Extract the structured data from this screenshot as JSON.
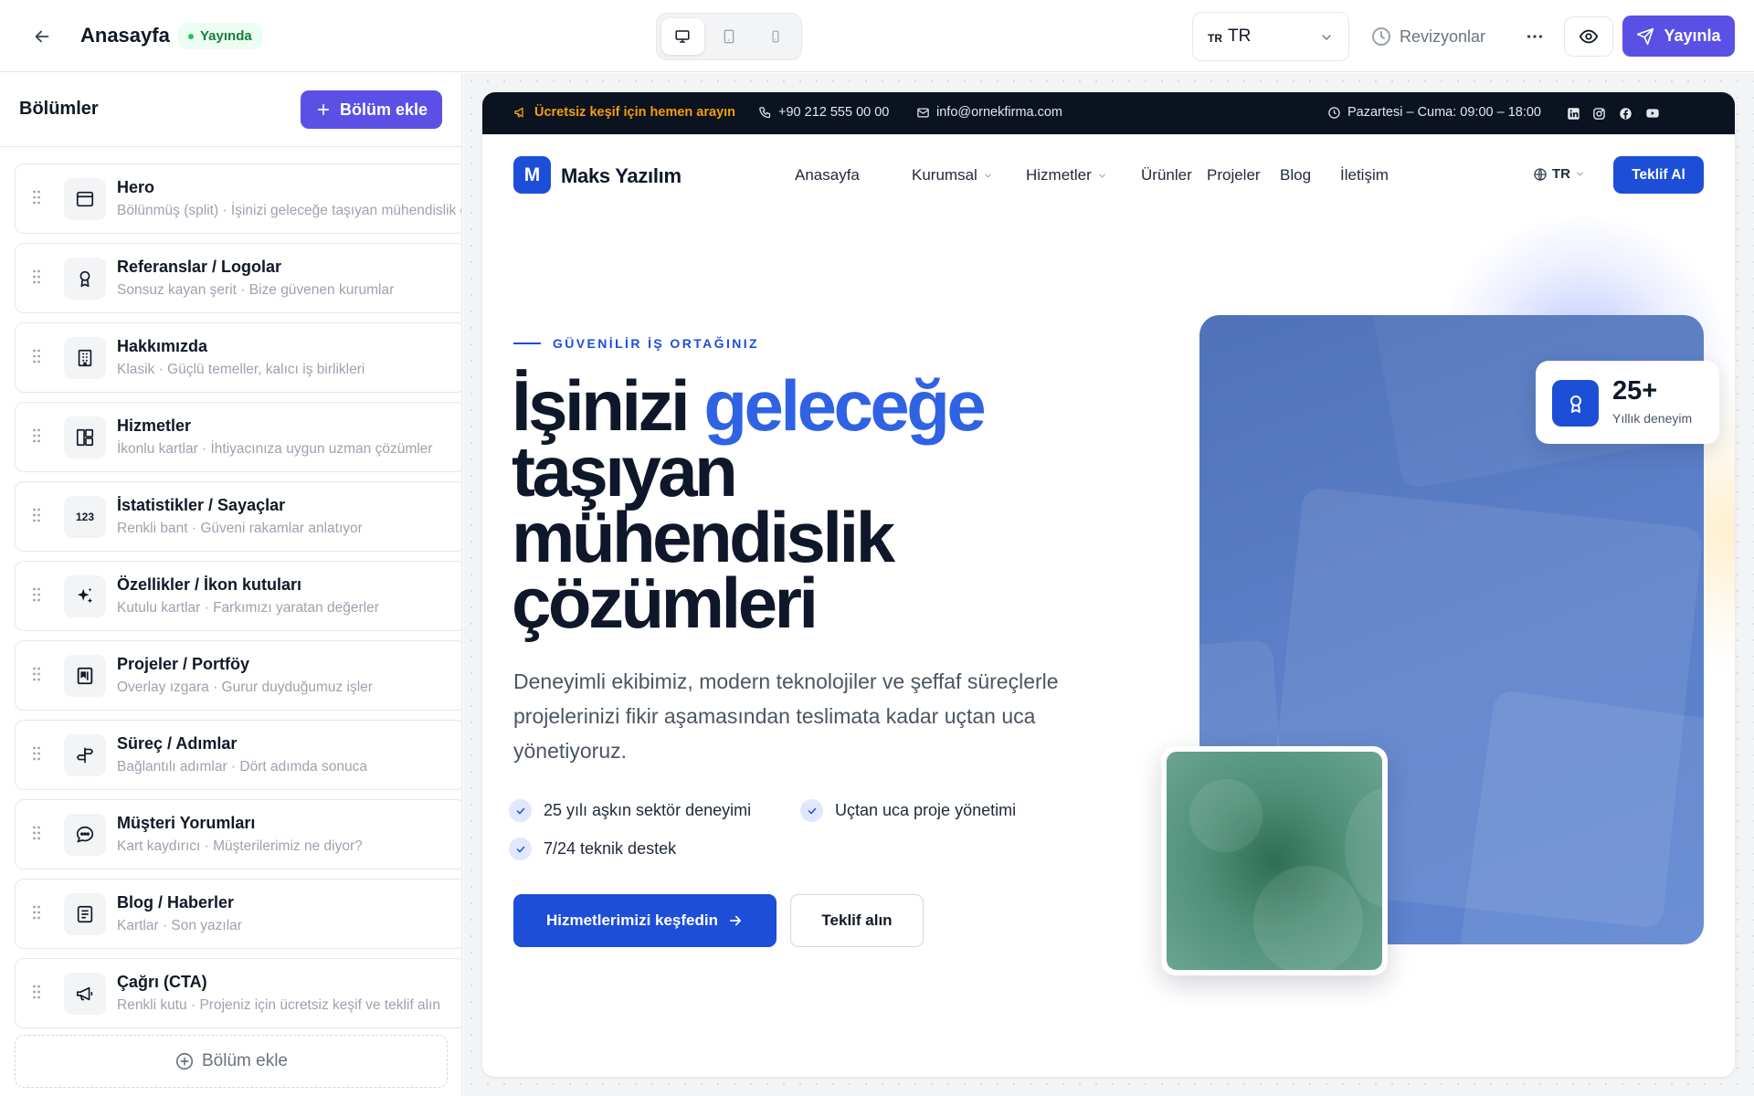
{
  "topbar": {
    "title": "Anasayfa",
    "status": "Yayında",
    "language_flag": "TR",
    "language_value": "TR",
    "revisions_label": "Revizyonlar",
    "publish_label": "Yayınla",
    "devices": [
      "desktop-icon",
      "tablet-icon",
      "mobile-icon"
    ],
    "active_device": "desktop"
  },
  "sidebar": {
    "title": "Bölümler",
    "add_button_label": "Bölüm ekle",
    "add_bottom_label": "Bölüm ekle",
    "sections": [
      {
        "title": "Hero",
        "subtitle": "Bölünmüş (split) · İşinizi geleceğe taşıyan mühendislik çözümleri",
        "icon": "layout-icon"
      },
      {
        "title": "Referanslar / Logolar",
        "subtitle": "Sonsuz kayan şerit · Bize güvenen kurumlar",
        "icon": "award-icon"
      },
      {
        "title": "Hakkımızda",
        "subtitle": "Klasik · Güçlü temeller, kalıcı iş birlikleri",
        "icon": "building-icon"
      },
      {
        "title": "Hizmetler",
        "subtitle": "İkonlu kartlar · İhtiyacınıza uygun uzman çözümler",
        "icon": "grid-icon"
      },
      {
        "title": "İstatistikler / Sayaçlar",
        "subtitle": "Renkli bant · Güveni rakamlar anlatıyor",
        "icon": "numbers-icon",
        "icon_text": "123"
      },
      {
        "title": "Özellikler / İkon kutuları",
        "subtitle": "Kutulu kartlar · Farkımızı yaratan değerler",
        "icon": "sparkles-icon"
      },
      {
        "title": "Projeler / Portföy",
        "subtitle": "Overlay ızgara · Gurur duyduğumuz işler",
        "icon": "portfolio-icon"
      },
      {
        "title": "Süreç / Adımlar",
        "subtitle": "Bağlantılı adımlar · Dört adımda sonuca",
        "icon": "signpost-icon"
      },
      {
        "title": "Müşteri Yorumları",
        "subtitle": "Kart kaydırıcı · Müşterilerimiz ne diyor?",
        "icon": "chat-icon"
      },
      {
        "title": "Blog / Haberler",
        "subtitle": "Kartlar · Son yazılar",
        "icon": "newspaper-icon"
      },
      {
        "title": "Çağrı (CTA)",
        "subtitle": "Renkli kutu · Projeniz için ücretsiz keşif ve teklif alın",
        "icon": "megaphone-icon"
      }
    ]
  },
  "preview": {
    "announce": {
      "cta": "Ücretsiz keşif için hemen arayın",
      "phone": "+90 212 555 00 00",
      "email": "info@ornekfirma.com",
      "hours": "Pazartesi – Cuma: 09:00 – 18:00",
      "socials": [
        "linkedin-icon",
        "instagram-icon",
        "facebook-icon",
        "youtube-icon"
      ]
    },
    "nav": {
      "logo_letter": "M",
      "logo_text": "Maks Yazılım",
      "links": [
        {
          "label": "Anasayfa",
          "dropdown": false
        },
        {
          "label": "Kurumsal",
          "dropdown": true
        },
        {
          "label": "Hizmetler",
          "dropdown": true
        },
        {
          "label": "Ürünler",
          "dropdown": false
        },
        {
          "label": "Projeler",
          "dropdown": false
        },
        {
          "label": "Blog",
          "dropdown": false
        },
        {
          "label": "İletişim",
          "dropdown": false
        }
      ],
      "lang": "TR",
      "cta": "Teklif Al"
    },
    "hero": {
      "eyebrow": "GÜVENİLİR İŞ ORTAĞINIZ",
      "title_part1": "İşinizi",
      "title_highlight": "geleceğe",
      "title_line2": "taşıyan",
      "title_line3": "mühendislik",
      "title_line4": "çözümleri",
      "description": "Deneyimli ekibimiz, modern teknolojiler ve şeffaf süreçlerle projelerinizi fikir aşamasından teslimata kadar uçtan uca yönetiyoruz.",
      "checks": [
        "25 yılı aşkın sektör deneyimi",
        "Uçtan uca proje yönetimi",
        "7/24 teknik destek"
      ],
      "primary_cta": "Hizmetlerimizi keşfedin",
      "secondary_cta": "Teklif alın",
      "experience_number": "25+",
      "experience_label": "Yıllık deneyim"
    }
  },
  "colors": {
    "accent": "#5b50e6",
    "site_primary": "#1d4ed8",
    "highlight": "#2f63e4",
    "announce_bg": "#0b1220",
    "announce_cta": "#f59e0b",
    "status_green": "#15803d"
  }
}
